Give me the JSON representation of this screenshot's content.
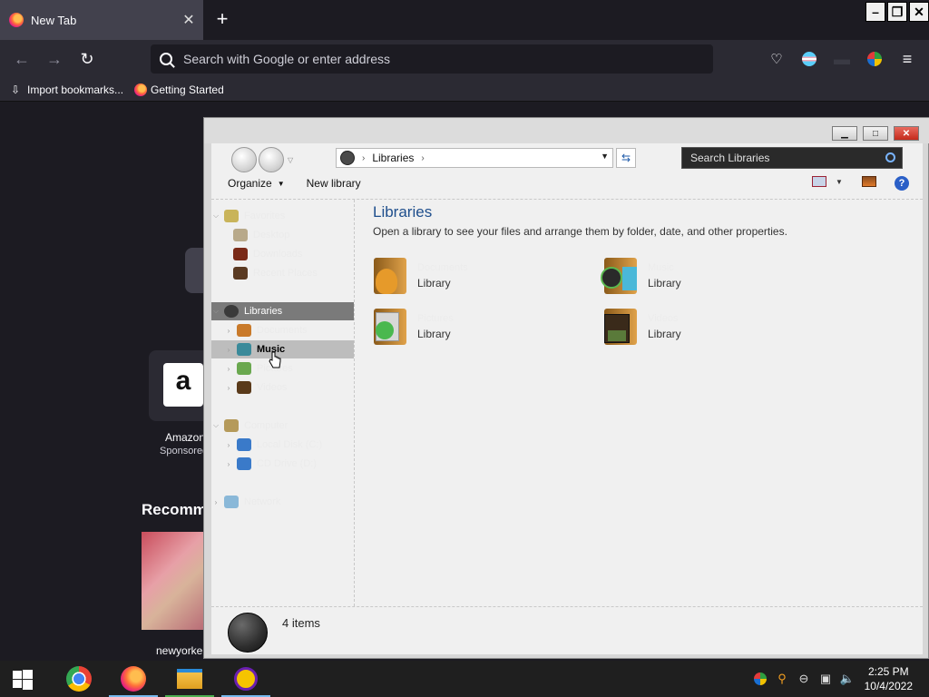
{
  "browser": {
    "tab_title": "New Tab",
    "url_placeholder": "Search with Google or enter address",
    "bookmarks": [
      "Import bookmarks...",
      "Getting Started"
    ]
  },
  "newtab": {
    "tile_label": "Amazon",
    "tile_sublabel": "Sponsored",
    "recommended_heading": "Recommended",
    "card_source": "newyorker"
  },
  "explorer": {
    "address_path": "Libraries",
    "search_placeholder": "Search Libraries",
    "commands": {
      "organize": "Organize",
      "new_library": "New library"
    },
    "nav_pane": {
      "favorites": "Favorites",
      "desktop": "Desktop",
      "downloads": "Downloads",
      "recent_places": "Recent Places",
      "libraries": "Libraries",
      "documents": "Documents",
      "music": "Music",
      "pictures": "Pictures",
      "videos": "Videos",
      "computer": "Computer",
      "local_disk": "Local Disk (C:)",
      "cd_drive": "CD Drive (D:)",
      "network": "Network"
    },
    "content": {
      "title": "Libraries",
      "description": "Open a library to see your files and arrange them by folder, date, and other properties.",
      "libraries": [
        {
          "name": "Documents",
          "kind": "Library"
        },
        {
          "name": "Music",
          "kind": "Library"
        },
        {
          "name": "Pictures",
          "kind": "Library"
        },
        {
          "name": "Videos",
          "kind": "Library"
        }
      ]
    },
    "status": "4 items"
  },
  "taskbar": {
    "time": "2:25 PM",
    "date": "10/4/2022"
  },
  "colors": {
    "firefox_bg": "#1c1b22",
    "firefox_toolbar": "#2b2a33",
    "explorer_bg": "#f0f0f0",
    "content_title": "#1e4e8c",
    "selection": "#7a7a7a",
    "taskbar": "#1f1f1f"
  }
}
